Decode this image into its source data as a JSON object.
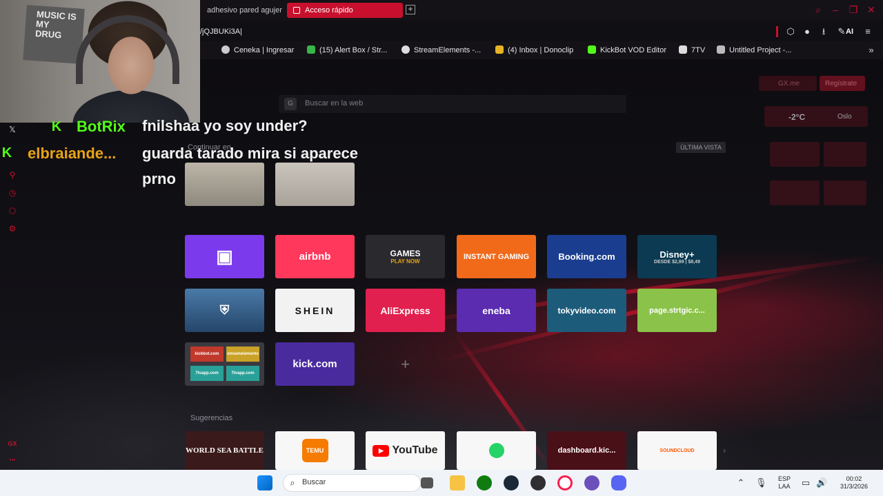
{
  "tabs": [
    {
      "label": "adhesivo pared agujer"
    },
    {
      "label": "Acceso rápido"
    }
  ],
  "address": {
    "url": "/jQJBUKi3A|"
  },
  "toolbar": {
    "ai_label": "AI"
  },
  "bookmarks": [
    {
      "label": "Ceneka | Ingresar"
    },
    {
      "label": "(15) Alert Box / Str..."
    },
    {
      "label": "StreamElements -..."
    },
    {
      "label": "(4) Inbox | Donoclip"
    },
    {
      "label": "KickBot VOD Editor"
    },
    {
      "label": "7TV"
    },
    {
      "label": "Untitled Project -..."
    }
  ],
  "webcam": {
    "poster_text": "MUSIC IS MY DRUG"
  },
  "chat": [
    {
      "user": "BotRix",
      "user_color": "#53fc18",
      "message": "fnilshaa yo soy under?"
    },
    {
      "user": "elbraiande...",
      "user_color": "#e8a317",
      "message": "guarda tarado mira si aparece prno"
    }
  ],
  "speeddial": {
    "search_placeholder": "Buscar en la web",
    "google_glyph": "G",
    "continue_label": "Continuar en",
    "last_view_label": "ÚLTIMA VISTA",
    "suggestions_label": "Sugerencias",
    "add_glyph": "+",
    "tiles": [
      {
        "label": "",
        "color": "#7c3aed"
      },
      {
        "label": "airbnb",
        "color": "#ff385c"
      },
      {
        "label": "GAMES",
        "sub": "PLAY NOW",
        "color": "#2a2a2e"
      },
      {
        "label": "INSTANT GAMING",
        "color": "#f06a1a"
      },
      {
        "label": "Booking.com",
        "color": "#1a3d8f"
      },
      {
        "label": "Disney+",
        "sub": "DESDE $2,99 | $8,49",
        "color": "#0b3a52"
      },
      {
        "label": "",
        "color": "#3a6a9a"
      },
      {
        "label": "SHEIN",
        "color": "#f2f2f2"
      },
      {
        "label": "AliExpress",
        "color": "#e1204f"
      },
      {
        "label": "eneba",
        "color": "#5b2bb0"
      },
      {
        "label": "tokyvideo.com",
        "color": "#1d5b7a"
      },
      {
        "label": "page.strtgic.c...",
        "color": "#8bc34a"
      },
      {
        "label": "",
        "color": "#3a3a40"
      },
      {
        "label": "kick.com",
        "color": "#4a2b9e"
      }
    ],
    "mini_tiles": [
      "kickbot.com",
      "streamelements",
      "7tvapp.com",
      "7tvapp.com"
    ],
    "suggestions": [
      {
        "label": "WORLD SEA BATTLE",
        "color": "#3a1a1a"
      },
      {
        "label": "TEMU",
        "color": "#f7f7f7"
      },
      {
        "label": "YouTube",
        "color": "#f7f7f7"
      },
      {
        "label": "",
        "color": "#f7f7f7"
      },
      {
        "label": "dashboard.kic...",
        "color": "#4a1018"
      },
      {
        "label": "SOUNDCLOUD",
        "color": "#f7f7f7"
      }
    ]
  },
  "widgets": {
    "gx_label": "GX.me",
    "register_label": "Regístrate",
    "temperature": "-2°C",
    "city": "Oslo"
  },
  "sidebar": {
    "gx_label": "GX",
    "more_glyph": "•••"
  },
  "taskbar": {
    "search_label": "Buscar",
    "lang": "ESP",
    "layout": "LAA",
    "time": "00:02",
    "date": "31/3/2026"
  }
}
